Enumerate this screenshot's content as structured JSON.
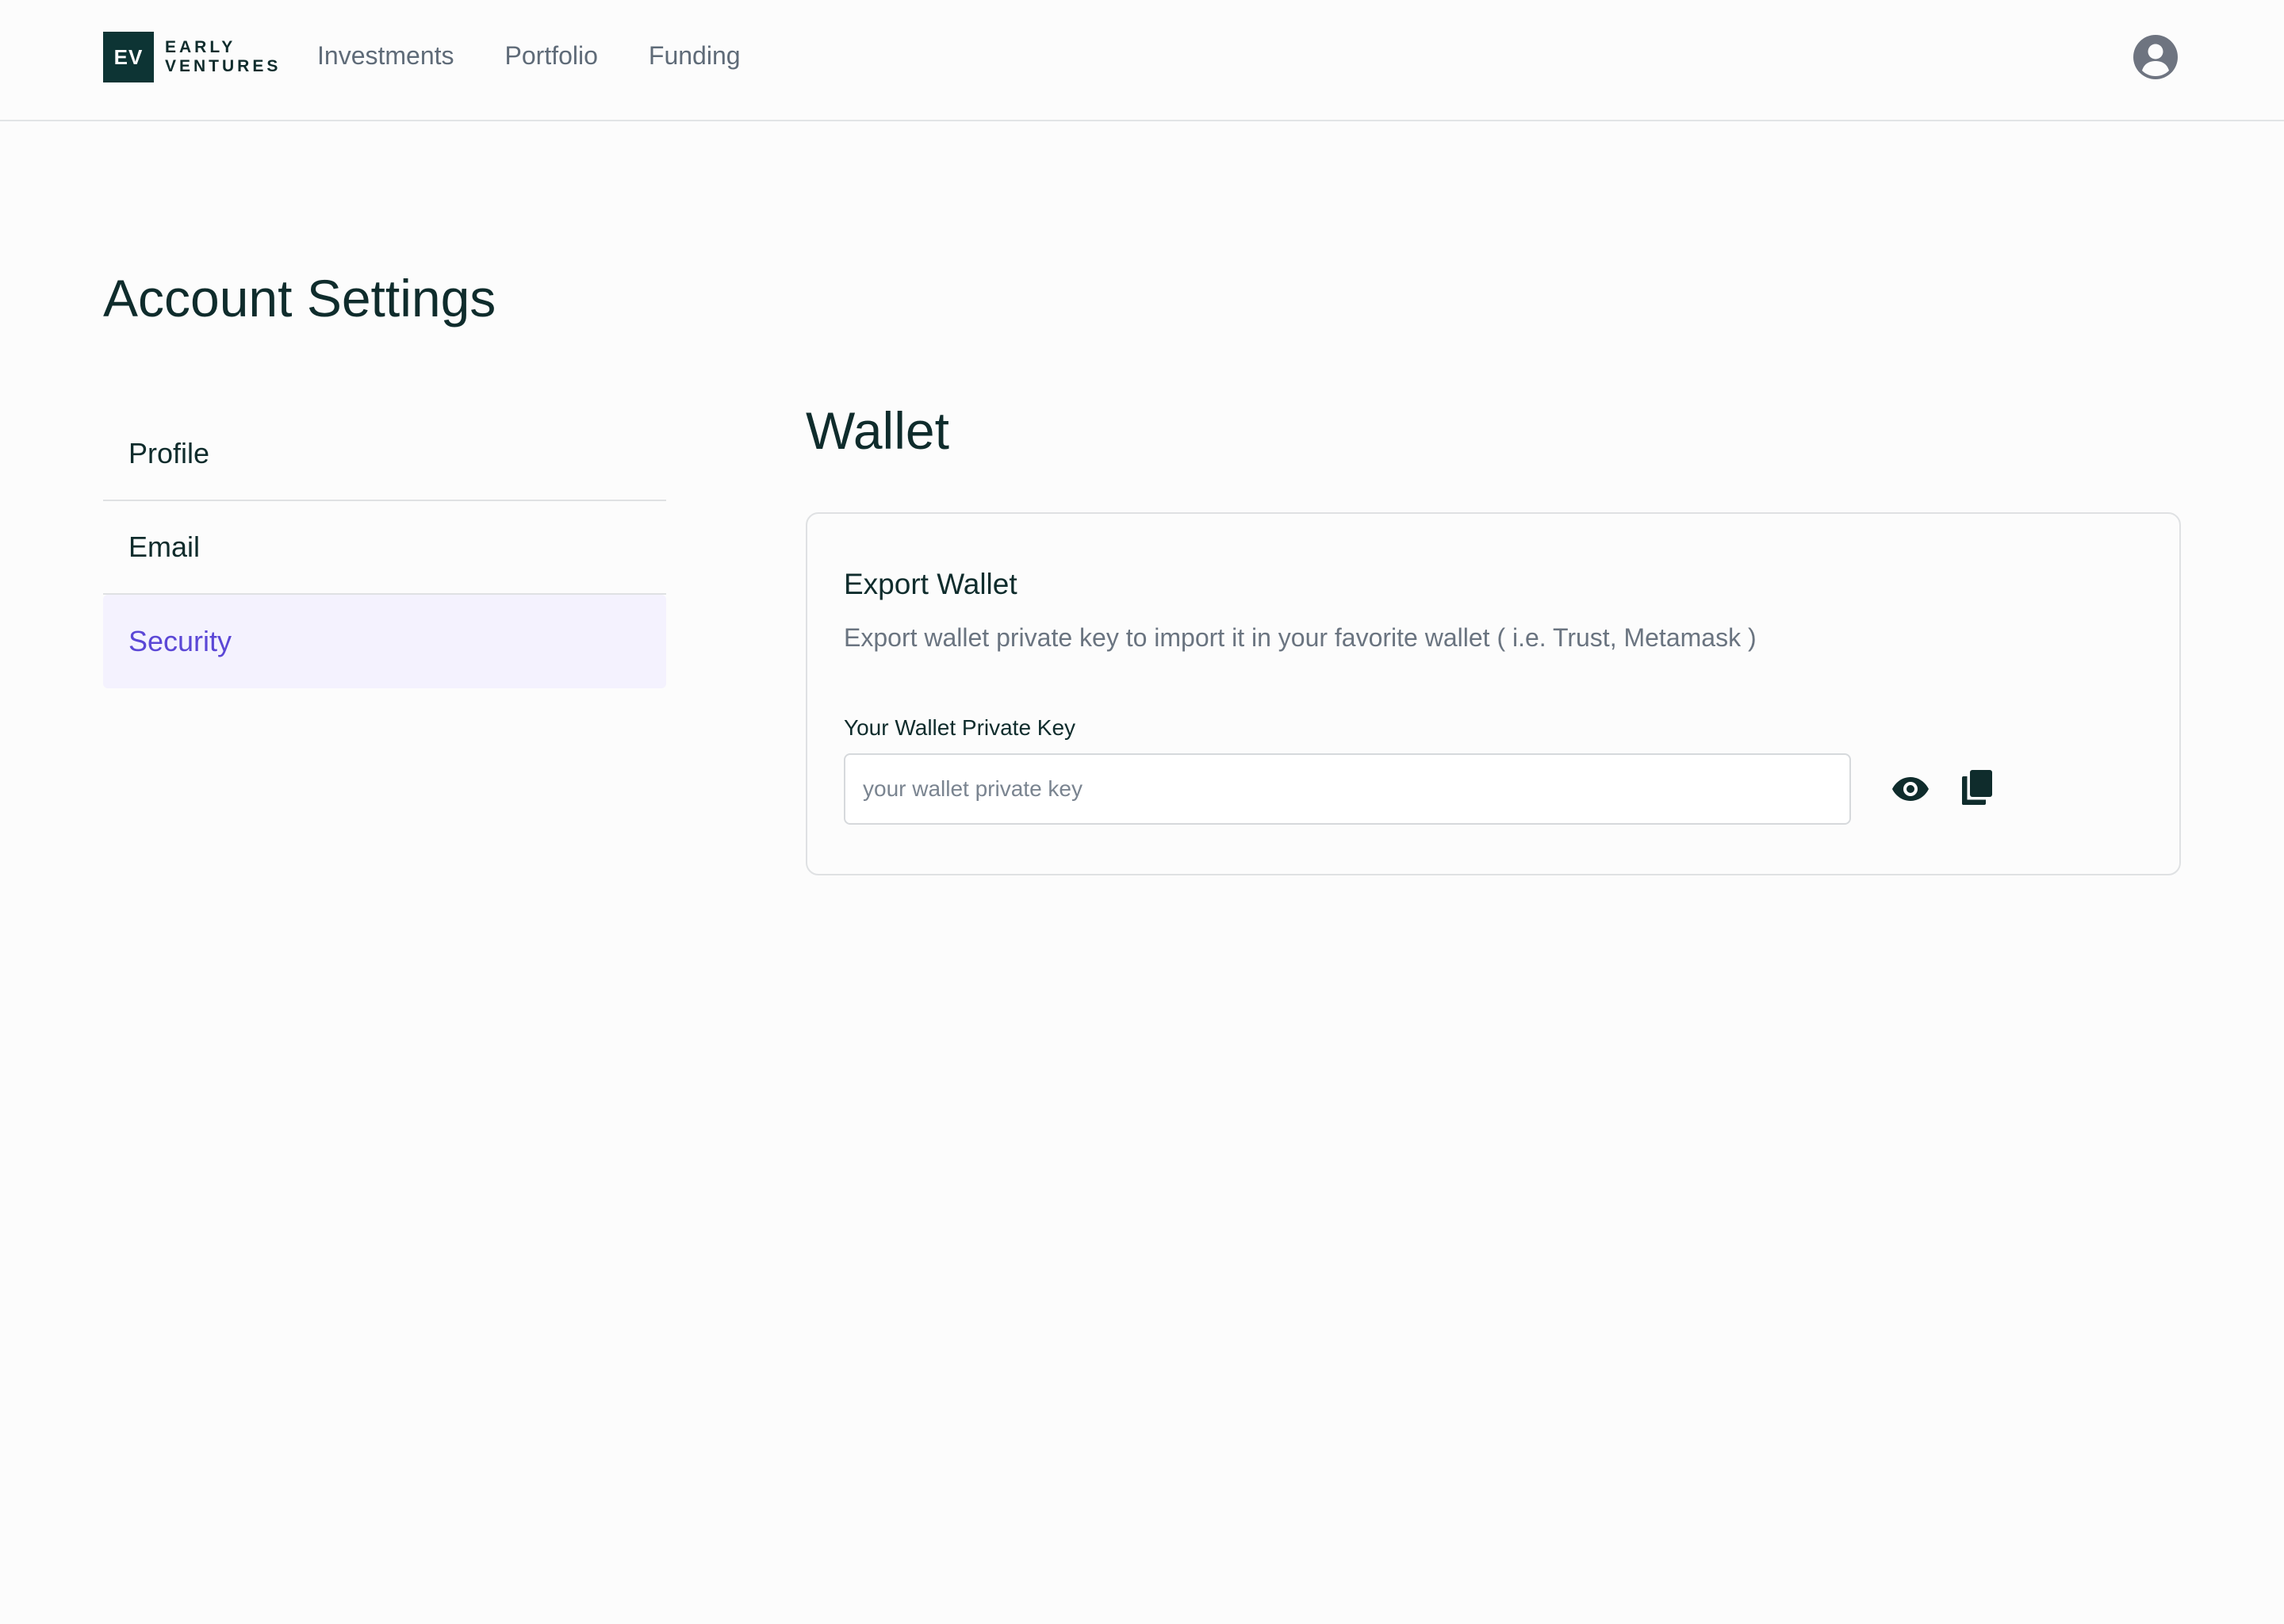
{
  "header": {
    "logo_mark": "EV",
    "logo_line1": "EARLY",
    "logo_line2": "VENTURES",
    "nav": [
      {
        "label": "Investments"
      },
      {
        "label": "Portfolio"
      },
      {
        "label": "Funding"
      }
    ],
    "avatar_icon": "user-circle-icon"
  },
  "page": {
    "title": "Account Settings"
  },
  "sidebar": {
    "items": [
      {
        "label": "Profile",
        "active": false
      },
      {
        "label": "Email",
        "active": false
      },
      {
        "label": "Security",
        "active": true
      }
    ]
  },
  "wallet": {
    "section_title": "Wallet",
    "card_title": "Export Wallet",
    "card_description": "Export wallet private key to import it in your favorite wallet ( i.e. Trust, Metamask )",
    "field_label": "Your Wallet Private Key",
    "input_value": "",
    "input_placeholder": "your wallet private key",
    "reveal_icon": "eye-icon",
    "copy_icon": "copy-icon"
  },
  "colors": {
    "brand_dark": "#0d3434",
    "accent": "#5b47d6",
    "active_bg": "#f4f2fe"
  }
}
